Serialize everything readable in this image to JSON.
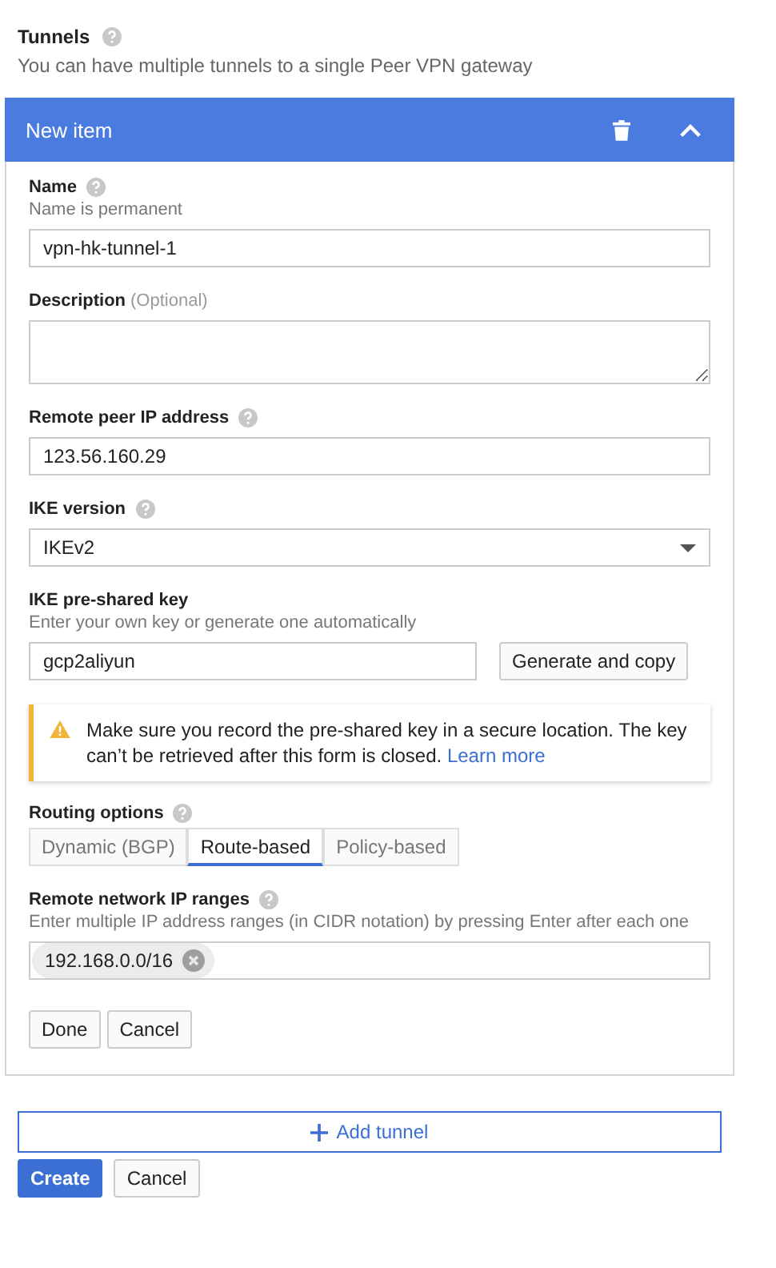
{
  "section": {
    "title": "Tunnels",
    "help": true,
    "subtitle": "You can have multiple tunnels to a single Peer VPN gateway"
  },
  "item": {
    "title": "New item",
    "expanded": true,
    "fields": [
      {
        "kind": "text",
        "label": "Name",
        "help": true,
        "hint": "Name is permanent",
        "value": "vpn-hk-tunnel-1"
      },
      {
        "kind": "textarea",
        "label": "Description",
        "optional": "(Optional)",
        "help": false
      },
      {
        "kind": "text",
        "label": "Remote peer IP address",
        "help": true,
        "value": "123.56.160.29"
      },
      {
        "kind": "select",
        "label": "IKE version",
        "help": true,
        "value": "IKEv2"
      },
      {
        "kind": "key",
        "label": "IKE pre-shared key",
        "help": false,
        "hint": "Enter your own key or generate one automatically",
        "value": "gcp2aliyun",
        "button": "Generate and copy"
      },
      {
        "kind": "warning",
        "text": "Make sure you record the pre-shared key in a secure location. The key can’t be retrieved after this form is closed.",
        "link": "Learn more"
      },
      {
        "kind": "tabs",
        "label": "Routing options",
        "help": true,
        "options": [
          {
            "label": "Dynamic (BGP)",
            "selected": false
          },
          {
            "label": "Route-based",
            "selected": true
          },
          {
            "label": "Policy-based",
            "selected": false
          }
        ]
      },
      {
        "kind": "chips",
        "label": "Remote network IP ranges",
        "help": true,
        "hint": "Enter multiple IP address ranges (in CIDR notation) by pressing Enter after each one",
        "chips": [
          "192.168.0.0/16"
        ]
      }
    ],
    "buttons": [
      "Done",
      "Cancel"
    ]
  },
  "add_button": "Add tunnel",
  "buttons": [
    {
      "label": "Create",
      "primary": true
    },
    {
      "label": "Cancel",
      "primary": false
    }
  ]
}
